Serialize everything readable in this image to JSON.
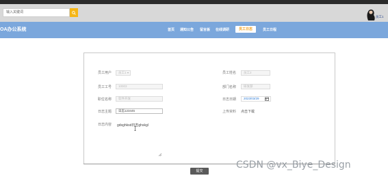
{
  "header": {
    "search_placeholder": "输入关键词",
    "user_name": "员工1"
  },
  "nav": {
    "brand": "OA办公系统",
    "items": [
      {
        "label": "首页"
      },
      {
        "label": "通知公告"
      },
      {
        "label": "留言板"
      },
      {
        "label": "在线调研"
      },
      {
        "label": "员工日志"
      },
      {
        "label": "员工日程"
      }
    ],
    "active_index": 4
  },
  "form": {
    "employee_account_label": "员工用户",
    "employee_account_value": "员工1",
    "employee_name_label": "员工姓名",
    "employee_name_value": "员工2",
    "employee_no_label": "员工工号",
    "employee_no_value": "10003",
    "department_label": "部门名称",
    "department_value": "研发部",
    "position_label": "职位名称",
    "position_value": "软件开发",
    "log_date_label": "日志日期",
    "log_date_value": "2023/03/29",
    "log_subject_label": "日志主题",
    "log_subject_value": "日志123445",
    "upload_label": "上传资料",
    "upload_link": "点击下载",
    "log_content_label": "日志内容",
    "log_content_value": "gdsghksd日志ghskgl",
    "submit_label": "提交"
  },
  "watermark": "CSDN @vx_Biye_Design",
  "colors": {
    "nav_bg": "#7ba7dc",
    "search_button": "#f6b616",
    "active_tab_text": "#f0a020"
  }
}
